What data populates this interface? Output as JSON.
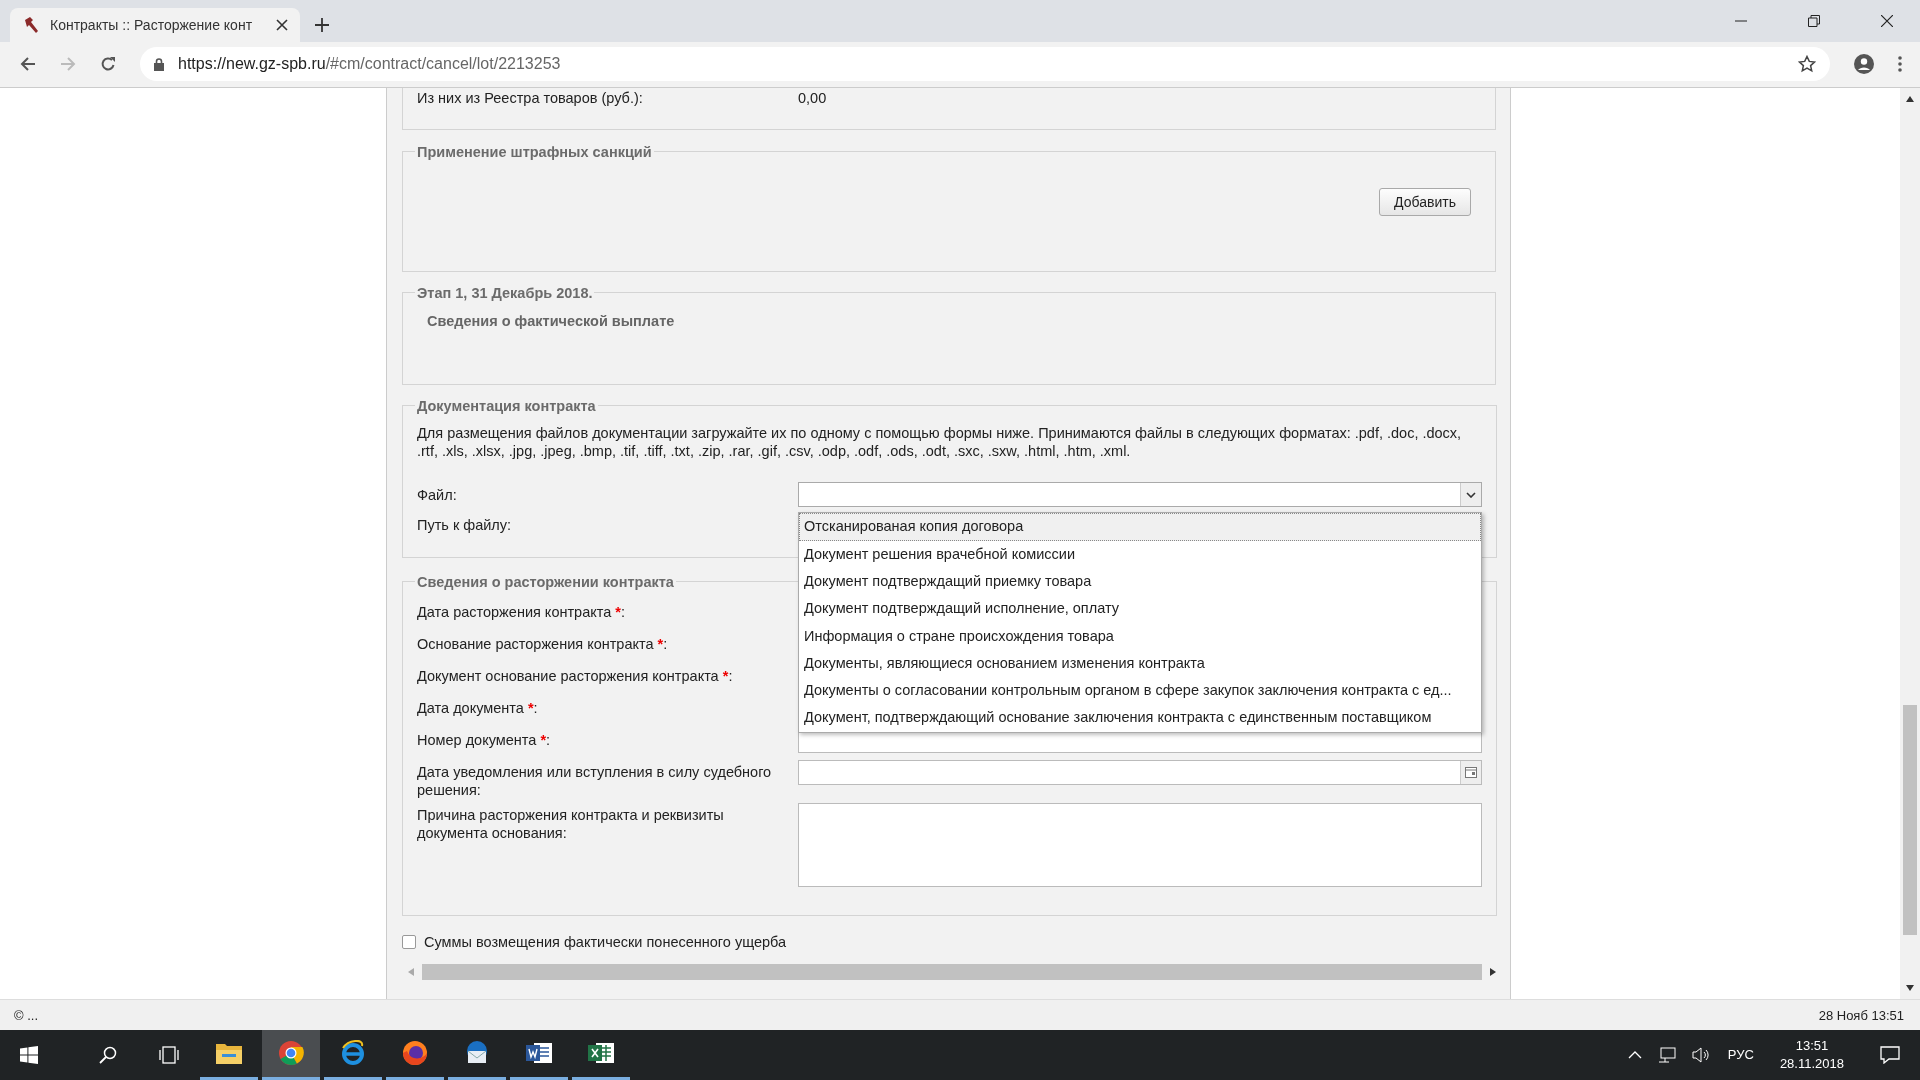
{
  "browser": {
    "tab_title": "Контракты :: Расторжение конт",
    "url_host": "https://new.gz-spb.ru",
    "url_path": "/#cm/contract/cancel/lot/2213253"
  },
  "summary_row": {
    "label": "Из них из Реестра товаров (руб.):",
    "value": "0,00"
  },
  "penalties": {
    "legend": "Применение штрафных санкций",
    "button": "Добавить"
  },
  "stage": {
    "legend": "Этап 1, 31 Декабрь 2018.",
    "subtitle": "Сведения о фактической выплате"
  },
  "documentation": {
    "legend": "Документация контракта",
    "description": "Для размещения файлов документации загружайте их по одному с помощью формы ниже. Принимаются файлы в следующих форматах: .pdf, .doc, .docx, .rtf, .xls, .xlsx, .jpg, .jpeg, .bmp, .tif, .tiff, .txt, .zip, .rar, .gif, .csv, .odp, .odf, .ods, .odt, .sxc, .sxw, .html, .htm, .xml.",
    "file_label": "Файл:",
    "path_label": "Путь к файлу:",
    "options": [
      {
        "label": "Отсканированая копия договора",
        "selected": true
      },
      {
        "label": "Документ решения врачебной комиссии",
        "selected": false
      },
      {
        "label": "Документ подтверждащий приемку товара",
        "selected": false
      },
      {
        "label": "Документ подтверждащий исполнение, оплату",
        "selected": false
      },
      {
        "label": "Информация о стране происхождения товара",
        "selected": false
      },
      {
        "label": "Документы, являющиеся основанием изменения контракта",
        "selected": false
      },
      {
        "label": "Документы о согласовании контрольным органом в сфере закупок заключения контракта с ед...",
        "selected": false
      },
      {
        "label": "Документ, подтверждающий основание заключения контракта с единственным поставщиком",
        "selected": false
      }
    ]
  },
  "termination": {
    "legend": "Сведения о расторжении контракта",
    "fields": [
      {
        "label": "Дата расторжения контракта ",
        "required_mark": "*",
        "suffix": ":"
      },
      {
        "label": "Основание расторжения контракта ",
        "required_mark": "*",
        "suffix": ":"
      },
      {
        "label": "Документ основание расторжения контракта ",
        "required_mark": "*",
        "suffix": ":"
      },
      {
        "label": "Дата документа ",
        "required_mark": "*",
        "suffix": ":"
      },
      {
        "label": "Номер документа ",
        "required_mark": "*",
        "suffix": ":",
        "kind": "text"
      },
      {
        "label": "Дата уведомления или вступления в силу судебного решения:",
        "kind": "date"
      },
      {
        "label": "Причина расторжения контракта и реквизиты документа основания:",
        "kind": "textarea"
      }
    ]
  },
  "damages_checkbox": {
    "label": "Суммы возмещения фактически понесенного ущерба",
    "checked": false
  },
  "status_bar": {
    "left": "© ...",
    "right": "28 Нояб 13:51"
  },
  "taskbar": {
    "apps": [
      {
        "kind": "explorer",
        "active": false
      },
      {
        "kind": "chrome",
        "active": true
      },
      {
        "kind": "ie",
        "active": false
      },
      {
        "kind": "firefox",
        "active": false
      },
      {
        "kind": "mail",
        "active": false
      },
      {
        "kind": "word",
        "active": false
      },
      {
        "kind": "excel",
        "active": false
      }
    ],
    "language": "РУС",
    "time": "13:51",
    "date": "28.11.2018"
  }
}
